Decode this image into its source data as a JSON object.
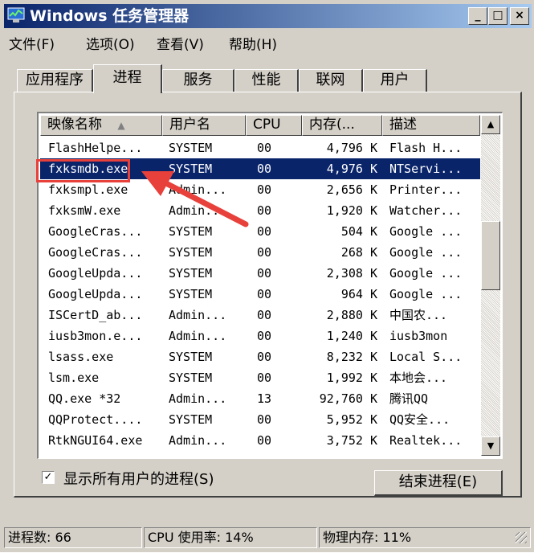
{
  "window": {
    "title": "Windows 任务管理器",
    "buttons": [
      "_",
      "□",
      "×"
    ]
  },
  "menu": [
    "文件(F)",
    "选项(O)",
    "查看(V)",
    "帮助(H)"
  ],
  "tabs": [
    {
      "label": "应用程序",
      "active": false
    },
    {
      "label": "进程",
      "active": true
    },
    {
      "label": "服务",
      "active": false
    },
    {
      "label": "性能",
      "active": false
    },
    {
      "label": "联网",
      "active": false
    },
    {
      "label": "用户",
      "active": false
    }
  ],
  "columns": [
    "映像名称",
    "用户名",
    "CPU",
    "内存(...",
    "描述"
  ],
  "sort_glyph": "▲",
  "rows": [
    {
      "name": "FlashHelpe...",
      "user": "SYSTEM",
      "cpu": "00",
      "mem": "4,796 K",
      "desc": "Flash H..."
    },
    {
      "name": "fxksmdb.exe",
      "user": "SYSTEM",
      "cpu": "00",
      "mem": "4,976 K",
      "desc": "NTServi..."
    },
    {
      "name": "fxksmpl.exe",
      "user": "Admin...",
      "cpu": "00",
      "mem": "2,656 K",
      "desc": "Printer..."
    },
    {
      "name": "fxksmW.exe",
      "user": "Admin...",
      "cpu": "00",
      "mem": "1,920 K",
      "desc": "Watcher..."
    },
    {
      "name": "GoogleCras...",
      "user": "SYSTEM",
      "cpu": "00",
      "mem": "504 K",
      "desc": "Google ..."
    },
    {
      "name": "GoogleCras...",
      "user": "SYSTEM",
      "cpu": "00",
      "mem": "268 K",
      "desc": "Google ..."
    },
    {
      "name": "GoogleUpda...",
      "user": "SYSTEM",
      "cpu": "00",
      "mem": "2,308 K",
      "desc": "Google ..."
    },
    {
      "name": "GoogleUpda...",
      "user": "SYSTEM",
      "cpu": "00",
      "mem": "964 K",
      "desc": "Google ..."
    },
    {
      "name": "ISCertD_ab...",
      "user": "Admin...",
      "cpu": "00",
      "mem": "2,880 K",
      "desc": "中国农..."
    },
    {
      "name": "iusb3mon.e...",
      "user": "Admin...",
      "cpu": "00",
      "mem": "1,240 K",
      "desc": "iusb3mon"
    },
    {
      "name": "lsass.exe",
      "user": "SYSTEM",
      "cpu": "00",
      "mem": "8,232 K",
      "desc": "Local S..."
    },
    {
      "name": "lsm.exe",
      "user": "SYSTEM",
      "cpu": "00",
      "mem": "1,992 K",
      "desc": "本地会..."
    },
    {
      "name": "QQ.exe *32",
      "user": "Admin...",
      "cpu": "13",
      "mem": "92,760 K",
      "desc": "腾讯QQ"
    },
    {
      "name": "QQProtect....",
      "user": "SYSTEM",
      "cpu": "00",
      "mem": "5,952 K",
      "desc": "QQ安全..."
    },
    {
      "name": "RtkNGUI64.exe",
      "user": "Admin...",
      "cpu": "00",
      "mem": "3,752 K",
      "desc": "Realtek..."
    }
  ],
  "selected_row": 1,
  "show_all_users": {
    "label": "显示所有用户的进程(S)",
    "checked": true
  },
  "end_process_label": "结束进程(E)",
  "status": {
    "processes": "进程数: 66",
    "cpu": "CPU 使用率: 14%",
    "memory": "物理内存: 11%"
  },
  "colors": {
    "annotation": "#e8403a",
    "selection": "#0a246a"
  }
}
